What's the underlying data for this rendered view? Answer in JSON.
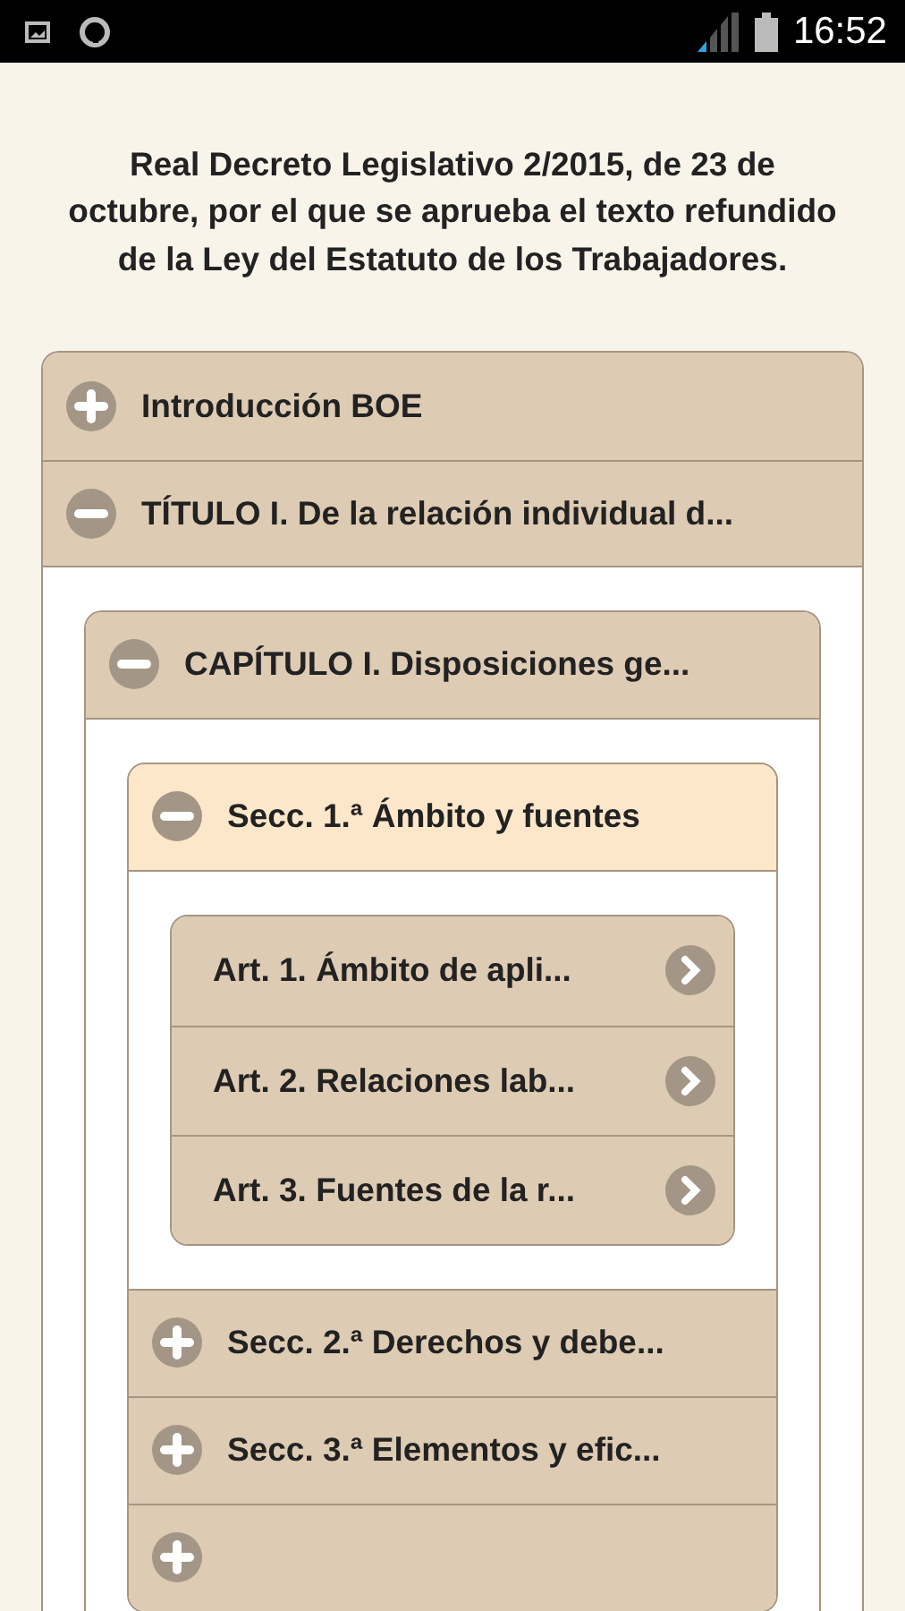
{
  "status_bar": {
    "time": "16:52"
  },
  "heading": "Real Decreto Legislativo 2/2015, de 23 de octubre, por el que se aprueba el texto refundido de la Ley del Estatuto de los Trabajadores.",
  "tree": [
    {
      "kind": "group",
      "label": "Introducción BOE",
      "expanded": false,
      "selected": false
    },
    {
      "kind": "group",
      "label": "TÍTULO I. De la relación individual d...",
      "expanded": true,
      "selected": false,
      "children": [
        {
          "kind": "group",
          "label": "CAPÍTULO I. Disposiciones ge...",
          "expanded": true,
          "selected": false,
          "children": [
            {
              "kind": "group",
              "label": "Secc. 1.ª Ámbito y fuentes",
              "expanded": true,
              "selected": true,
              "children": [
                {
                  "kind": "article",
                  "label": "Art. 1. Ámbito de apli..."
                },
                {
                  "kind": "article",
                  "label": "Art. 2. Relaciones lab..."
                },
                {
                  "kind": "article",
                  "label": "Art. 3. Fuentes de la r..."
                }
              ]
            },
            {
              "kind": "group",
              "label": "Secc. 2.ª Derechos y debe...",
              "expanded": false,
              "selected": false
            },
            {
              "kind": "group",
              "label": "Secc. 3.ª Elementos y efic...",
              "expanded": false,
              "selected": false
            },
            {
              "kind": "group",
              "expanded": false,
              "selected": false
            }
          ]
        }
      ]
    }
  ]
}
